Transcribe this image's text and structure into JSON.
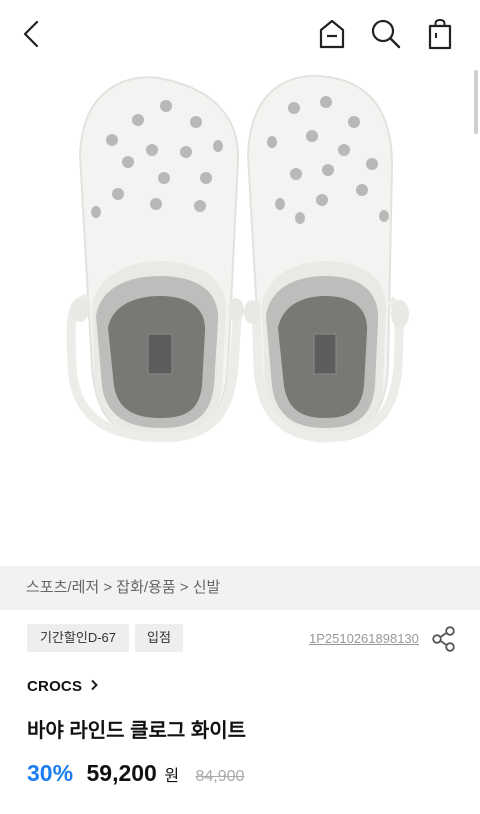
{
  "header": {
    "back_icon": "chevron-left-icon",
    "home_icon": "home-icon",
    "search_icon": "search-icon",
    "bag_icon": "shopping-bag-icon"
  },
  "product_image": {
    "alt": "바야 라인드 클로그 화이트"
  },
  "breadcrumb": "스포츠/레저 > 잡화/용품 > 신발",
  "tags": [
    "기간할인D-67",
    "입점"
  ],
  "product_code": "1P2510261898130",
  "brand": "CROCS",
  "title": "바야 라인드 클로그 화이트",
  "price": {
    "discount": "30%",
    "current": "59,200",
    "currency": "원",
    "original": "84,900"
  },
  "colors": {
    "accent": "#1c7ef0",
    "breadcrumb_bg": "#f2f2f2",
    "tag_bg": "#eeeeee"
  }
}
